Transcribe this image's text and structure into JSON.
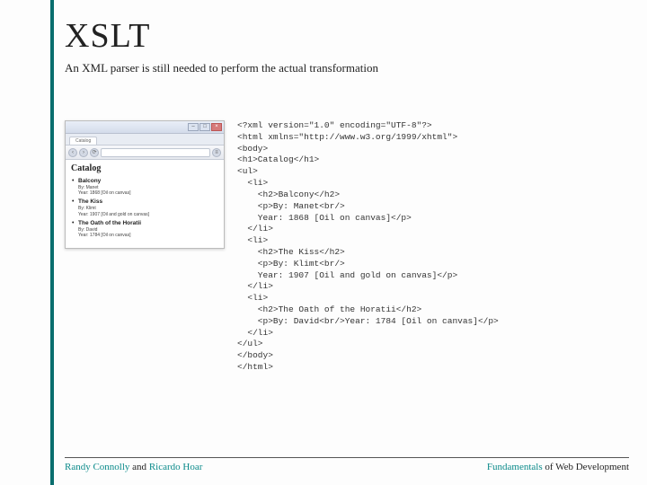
{
  "title": "XSLT",
  "subtitle": "An XML parser is still needed to perform the actual transformation",
  "browser": {
    "tab_label": "Catalog",
    "page_heading": "Catalog",
    "items": [
      {
        "title": "Balcony",
        "by": "By: Manet",
        "year": "Year: 1868 [Oil on canvas]"
      },
      {
        "title": "The Kiss",
        "by": "By: Klimt",
        "year": "Year: 1907 [Oil and gold on canvas]"
      },
      {
        "title": "The Oath of the Horatii",
        "by": "By: David",
        "year": "Year: 1784 [Oil on canvas]"
      }
    ]
  },
  "code_lines": [
    "<?xml version=\"1.0\" encoding=\"UTF-8\"?>",
    "<html xmlns=\"http://www.w3.org/1999/xhtml\">",
    "<body>",
    "<h1>Catalog</h1>",
    "<ul>",
    "  <li>",
    "    <h2>Balcony</h2>",
    "    <p>By: Manet<br/>",
    "    Year: 1868 [Oil on canvas]</p>",
    "  </li>",
    "  <li>",
    "    <h2>The Kiss</h2>",
    "    <p>By: Klimt<br/>",
    "    Year: 1907 [Oil and gold on canvas]</p>",
    "  </li>",
    "  <li>",
    "    <h2>The Oath of the Horatii</h2>",
    "    <p>By: David<br/>Year: 1784 [Oil on canvas]</p>",
    "  </li>",
    "</ul>",
    "</body>",
    "</html>"
  ],
  "footer": {
    "left_teal1": "Randy Connolly",
    "left_plain": " and ",
    "left_teal2": "Ricardo Hoar",
    "right_teal": "Fundamentals",
    "right_plain": " of Web Development"
  }
}
